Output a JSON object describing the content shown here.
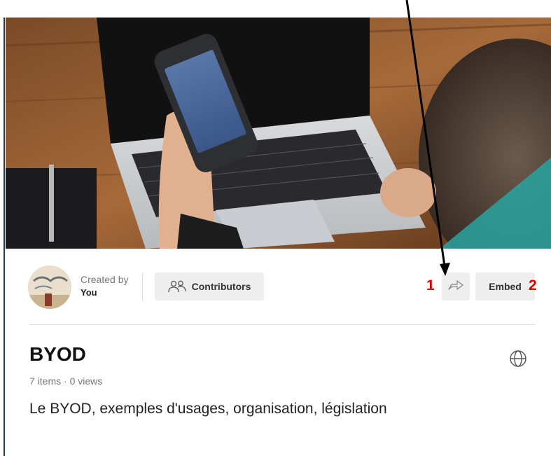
{
  "creator": {
    "label": "Created by",
    "name": "You"
  },
  "buttons": {
    "contributors_label": "Contributors",
    "embed_label": "Embed"
  },
  "annotations": {
    "badge_1": "1",
    "badge_2": "2",
    "color": "#e00000"
  },
  "collection": {
    "title": "BYOD",
    "meta": "7 items · 0 views",
    "description": "Le BYOD, exemples d'usages, organisation, législation"
  },
  "icons": {
    "contributors": "people-icon",
    "share": "share-arrow-icon",
    "visibility": "globe-icon"
  }
}
